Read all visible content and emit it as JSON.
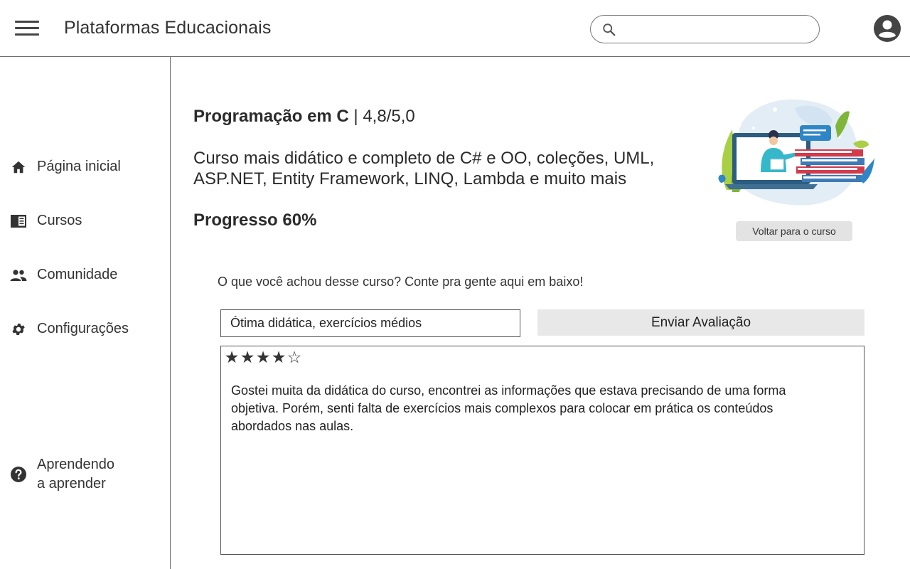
{
  "header": {
    "app_title": "Plataformas Educacionais",
    "search": {
      "placeholder": "",
      "value": ""
    }
  },
  "sidebar": {
    "items": [
      {
        "label": "Página inicial",
        "icon": "home-icon"
      },
      {
        "label": "Cursos",
        "icon": "courses-icon"
      },
      {
        "label": "Comunidade",
        "icon": "people-icon"
      },
      {
        "label": "Configurações",
        "icon": "gear-icon"
      }
    ],
    "help": {
      "line1": "Aprendendo",
      "line2": "a aprender",
      "icon": "help-icon"
    }
  },
  "course": {
    "name": "Programação em C",
    "rating": " | 4,8/5,0",
    "description": "Curso mais didático e completo de C# e OO, coleções, UML, ASP.NET, Entity Framework, LINQ, Lambda e muito mais",
    "progress_label": "Progresso 60%",
    "progress_percent": 60,
    "back_button": "Voltar para o curso"
  },
  "review": {
    "prompt": "O que você achou desse curso? Conte pra gente aqui em baixo!",
    "title_value": "Ótima didática, exercícios médios",
    "submit_label": "Enviar Avaliação",
    "stars_filled": 4,
    "stars_total": 5,
    "star_filled_glyph": "★",
    "star_empty_glyph": "☆",
    "text": "Gostei muita da didática do curso, encontrei as informações que estava precisando de uma forma objetiva. Porém, senti falta de exercícios mais complexos para colocar em prática os conteúdos abordados nas aulas."
  },
  "colors": {
    "text": "#2b2b2b",
    "border": "#6f6f6f",
    "button_bg": "#e8e8e8",
    "icon": "#444444"
  }
}
